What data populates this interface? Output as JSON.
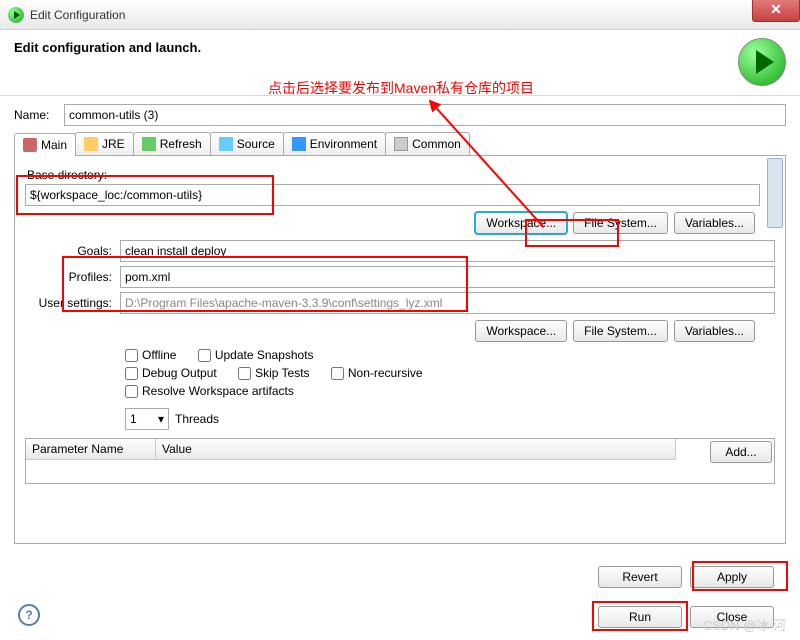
{
  "window": {
    "title": "Edit Configuration"
  },
  "header": {
    "title": "Edit configuration and launch."
  },
  "name": {
    "label": "Name:",
    "value": "common-utils (3)"
  },
  "tabs": {
    "main": "Main",
    "jre": "JRE",
    "refresh": "Refresh",
    "source": "Source",
    "env": "Environment",
    "common": "Common"
  },
  "main": {
    "base_dir_label": "Base directory:",
    "base_dir_value": "${workspace_loc:/common-utils}",
    "btn_workspace": "Workspace...",
    "btn_filesystem": "File System...",
    "btn_variables": "Variables...",
    "goals_label": "Goals:",
    "goals_value": "clean install deploy",
    "profiles_label": "Profiles:",
    "profiles_value": "pom.xml",
    "usersettings_label": "User settings:",
    "usersettings_value": "D:\\Program Files\\apache-maven-3.3.9\\conf\\settings_lyz.xml",
    "chk_offline": "Offline",
    "chk_update": "Update Snapshots",
    "chk_debug": "Debug Output",
    "chk_skip": "Skip Tests",
    "chk_nonrec": "Non-recursive",
    "chk_resolve": "Resolve Workspace artifacts",
    "threads_value": "1",
    "threads_label": "Threads",
    "col_param": "Parameter Name",
    "col_value": "Value",
    "btn_add": "Add..."
  },
  "buttons": {
    "revert": "Revert",
    "apply": "Apply",
    "run": "Run",
    "close": "Close"
  },
  "annotation": {
    "text": "点击后选择要发布到Maven私有仓库的项目"
  },
  "watermark": "CSDN @冰 河"
}
